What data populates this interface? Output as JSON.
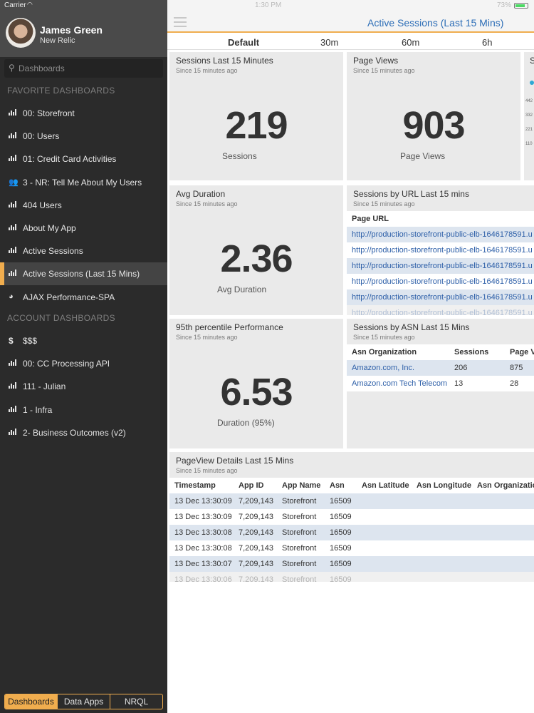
{
  "status": {
    "carrier": "Carrier",
    "time": "1:30 PM",
    "battery": "73%"
  },
  "profile": {
    "name": "James Green",
    "org": "New Relic"
  },
  "search": {
    "placeholder": "Dashboards"
  },
  "sidebar": {
    "favorites_header": "FAVORITE DASHBOARDS",
    "favorites": [
      {
        "label": "00: Storefront",
        "icon": "bar-chart-icon"
      },
      {
        "label": "00: Users",
        "icon": "bar-chart-icon"
      },
      {
        "label": "01: Credit Card Activities",
        "icon": "bar-chart-icon"
      },
      {
        "label": "3 - NR: Tell Me About My Users",
        "icon": "users-icon"
      },
      {
        "label": "404 Users",
        "icon": "bar-chart-icon"
      },
      {
        "label": "About My App",
        "icon": "bar-chart-icon"
      },
      {
        "label": "Active Sessions",
        "icon": "bar-chart-icon"
      },
      {
        "label": "Active Sessions (Last 15 Mins)",
        "icon": "bar-chart-icon"
      },
      {
        "label": "AJAX Performance-SPA",
        "icon": "gauge-icon"
      }
    ],
    "account_header": "ACCOUNT DASHBOARDS",
    "account": [
      {
        "label": "$$$",
        "icon": "dollar-icon"
      },
      {
        "label": "00: CC Processing API",
        "icon": "bar-chart-icon"
      },
      {
        "label": "111 - Julian",
        "icon": "bar-chart-icon"
      },
      {
        "label": "1 - Infra",
        "icon": "bar-chart-icon"
      },
      {
        "label": "2- Business Outcomes (v2)",
        "icon": "bar-chart-icon"
      }
    ],
    "bottom_tabs": [
      "Dashboards",
      "Data Apps",
      "NRQL"
    ]
  },
  "header": {
    "title": "Active Sessions (Last 15 Mins)"
  },
  "time_ranges": [
    "Default",
    "30m",
    "60m",
    "6h"
  ],
  "cards": {
    "sessions": {
      "title": "Sessions Last 15 Minutes",
      "sub": "Since 15 minutes ago",
      "value": "219",
      "label": "Sessions"
    },
    "pageviews": {
      "title": "Page Views",
      "sub": "Since 15 minutes ago",
      "value": "903",
      "label": "Page Views"
    },
    "partial": {
      "title": "S",
      "ticks": [
        "442",
        "332",
        "221",
        "110"
      ]
    },
    "duration": {
      "title": "Avg Duration",
      "sub": "Since 15 minutes ago",
      "value": "2.36",
      "label": "Avg Duration"
    },
    "url": {
      "title": "Sessions by URL Last 15 mins",
      "sub": "Since 15 minutes ago",
      "header": "Page URL",
      "rows": [
        "http://production-storefront-public-elb-1646178591.u",
        "http://production-storefront-public-elb-1646178591.u",
        "http://production-storefront-public-elb-1646178591.u",
        "http://production-storefront-public-elb-1646178591.u",
        "http://production-storefront-public-elb-1646178591.u",
        "http://production-storefront-public-elb-1646178591.u"
      ]
    },
    "p95": {
      "title": "95th percentile Performance",
      "sub": "Since 15 minutes ago",
      "value": "6.53",
      "label": "Duration (95%)"
    },
    "asn": {
      "title": "Sessions by ASN Last 15 Mins",
      "sub": "Since 15 minutes ago",
      "headers": [
        "Asn Organization",
        "Sessions",
        "Page V"
      ],
      "rows": [
        [
          "Amazon.com, Inc.",
          "206",
          "875"
        ],
        [
          "Amazon.com Tech Telecom",
          "13",
          "28"
        ]
      ]
    },
    "details": {
      "title": "PageView Details Last 15 Mins",
      "sub": "Since 15 minutes ago",
      "headers": [
        "Timestamp",
        "App ID",
        "App Name",
        "Asn",
        "Asn Latitude",
        "Asn Longitude",
        "Asn Organization"
      ],
      "rows": [
        [
          "13 Dec 13:30:09",
          "7,209,143",
          "Storefront",
          "16509"
        ],
        [
          "13 Dec 13:30:09",
          "7,209,143",
          "Storefront",
          "16509"
        ],
        [
          "13 Dec 13:30:08",
          "7,209,143",
          "Storefront",
          "16509"
        ],
        [
          "13 Dec 13:30:08",
          "7,209,143",
          "Storefront",
          "16509"
        ],
        [
          "13 Dec 13:30:07",
          "7,209,143",
          "Storefront",
          "16509"
        ],
        [
          "13 Dec 13:30:06",
          "7,209,143",
          "Storefront",
          "16509"
        ]
      ]
    }
  },
  "colors": {
    "accent": "#f0ad4e",
    "link": "#2d5fa8",
    "title": "#2d6eb7",
    "sidebar": "#2b2b2b"
  }
}
